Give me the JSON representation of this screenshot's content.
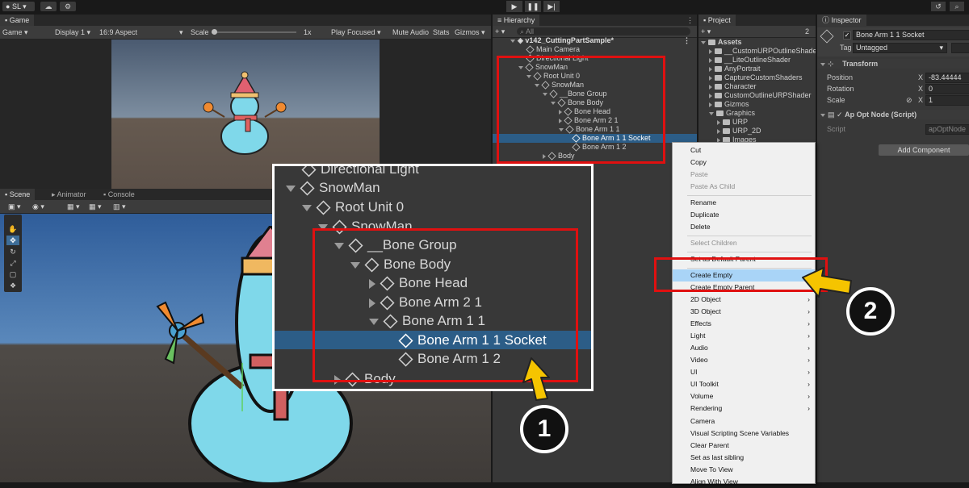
{
  "top_bar": {
    "account_label": "SL",
    "play_icon": "play-icon",
    "pause_icon": "pause-icon",
    "step_icon": "step-icon"
  },
  "game_view": {
    "tab": "Game",
    "display_mode": "Game",
    "display": "Display 1",
    "aspect": "16:9 Aspect",
    "scale_label": "Scale",
    "scale_value": "1x",
    "play_focused": "Play Focused",
    "mute_audio": "Mute Audio",
    "stats": "Stats",
    "gizmos": "Gizmos"
  },
  "scene_view": {
    "tabs": [
      "Scene",
      "Animator",
      "Console"
    ]
  },
  "hierarchy": {
    "tab": "Hierarchy",
    "search_placeholder": "All",
    "scene_name": "v142_CuttingPartSample*",
    "items": [
      {
        "label": "Main Camera"
      },
      {
        "label": "Directional Light"
      },
      {
        "label": "SnowMan"
      },
      {
        "label": "Root Unit 0"
      },
      {
        "label": "SnowMan"
      },
      {
        "label": "__Bone Group"
      },
      {
        "label": "Bone Body"
      },
      {
        "label": "Bone Head"
      },
      {
        "label": "Bone Arm 2 1"
      },
      {
        "label": "Bone Arm 1 1"
      },
      {
        "label": "Bone Arm 1 1 Socket"
      },
      {
        "label": "Bone Arm 1 2"
      },
      {
        "label": "Body"
      }
    ]
  },
  "project": {
    "tab": "Project",
    "count": "2",
    "root": "Assets",
    "folders": [
      "__CustomURPOutlineShader",
      "__LiteOutlineShader",
      "AnyPortrait",
      "CaptureCustomShaders",
      "Character",
      "CustomOutlineURPShader",
      "Gizmos",
      "Graphics",
      "URP",
      "URP_2D",
      "Images"
    ]
  },
  "inspector": {
    "tab": "Inspector",
    "object_name": "Bone Arm 1 1 Socket",
    "tag_label": "Tag",
    "tag_value": "Untagged",
    "transform_title": "Transform",
    "position_label": "Position",
    "rotation_label": "Rotation",
    "scale_label": "Scale",
    "axis_x": "X",
    "position_x": "-83.44444",
    "rotation_x": "0",
    "scale_x": "1",
    "component_title": "Ap Opt Node (Script)",
    "script_label": "Script",
    "script_value": "apOptNode",
    "add_component": "Add Component"
  },
  "context_menu": {
    "items": [
      {
        "label": "Cut",
        "disabled": false
      },
      {
        "label": "Copy",
        "disabled": false
      },
      {
        "label": "Paste",
        "disabled": true
      },
      {
        "label": "Paste As Child",
        "disabled": true
      },
      {
        "label": "Rename",
        "disabled": false
      },
      {
        "label": "Duplicate",
        "disabled": false
      },
      {
        "label": "Delete",
        "disabled": false
      },
      {
        "label": "Select Children",
        "disabled": true
      },
      {
        "label": "Set as Default Parent",
        "disabled": false
      },
      {
        "label": "Create Empty",
        "disabled": false
      },
      {
        "label": "Create Empty Parent",
        "disabled": false
      },
      {
        "label": "2D Object",
        "disabled": false
      },
      {
        "label": "3D Object",
        "disabled": false
      },
      {
        "label": "Effects",
        "disabled": false
      },
      {
        "label": "Light",
        "disabled": false
      },
      {
        "label": "Audio",
        "disabled": false
      },
      {
        "label": "Video",
        "disabled": false
      },
      {
        "label": "UI",
        "disabled": false
      },
      {
        "label": "UI Toolkit",
        "disabled": false
      },
      {
        "label": "Volume",
        "disabled": false
      },
      {
        "label": "Rendering",
        "disabled": false
      },
      {
        "label": "Camera",
        "disabled": false
      },
      {
        "label": "Visual Scripting Scene Variables",
        "disabled": false
      },
      {
        "label": "Clear Parent",
        "disabled": false
      },
      {
        "label": "Set as last sibling",
        "disabled": false
      },
      {
        "label": "Move To View",
        "disabled": false
      },
      {
        "label": "Align With View",
        "disabled": false
      }
    ],
    "submenu_arrow": "›"
  },
  "zoom_callout": {
    "rows": [
      "Directional Light",
      "SnowMan",
      "Root Unit 0",
      "SnowMan",
      "__Bone Group",
      "Bone Body",
      "Bone Head",
      "Bone Arm 2 1",
      "Bone Arm 1 1",
      "Bone Arm 1 1 Socket",
      "Bone Arm 1 2",
      "Body"
    ]
  },
  "annotations": {
    "step1": "1",
    "step2": "2"
  },
  "colors": {
    "selection": "#2c5d87",
    "highlight_box": "#e01010",
    "callout_arrow": "#f5c400",
    "menu_highlight": "#a9d4f7"
  }
}
